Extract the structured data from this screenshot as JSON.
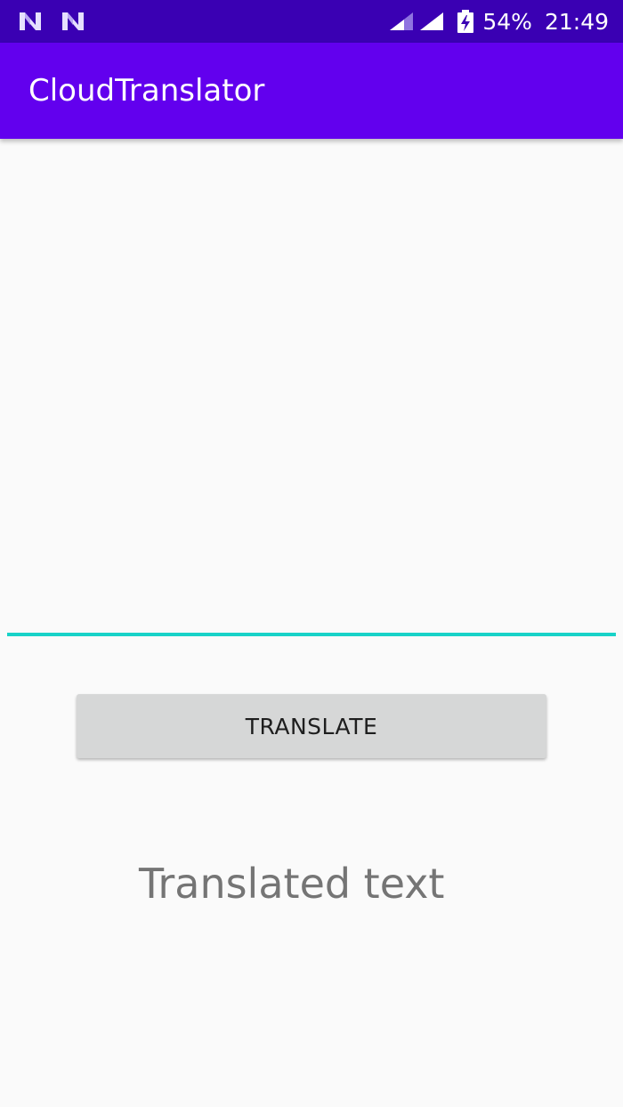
{
  "status_bar": {
    "notification_icons": [
      "n-notification-icon",
      "n-notification-icon"
    ],
    "battery_percent": "54%",
    "time": "21:49",
    "background_color": "#3a00b3"
  },
  "app_bar": {
    "title": "CloudTranslator",
    "background_color": "#6200ee"
  },
  "input": {
    "value": "",
    "underline_color": "#18d2c8"
  },
  "translate_button": {
    "label": "TRANSLATE"
  },
  "output": {
    "text": "Translated text"
  }
}
